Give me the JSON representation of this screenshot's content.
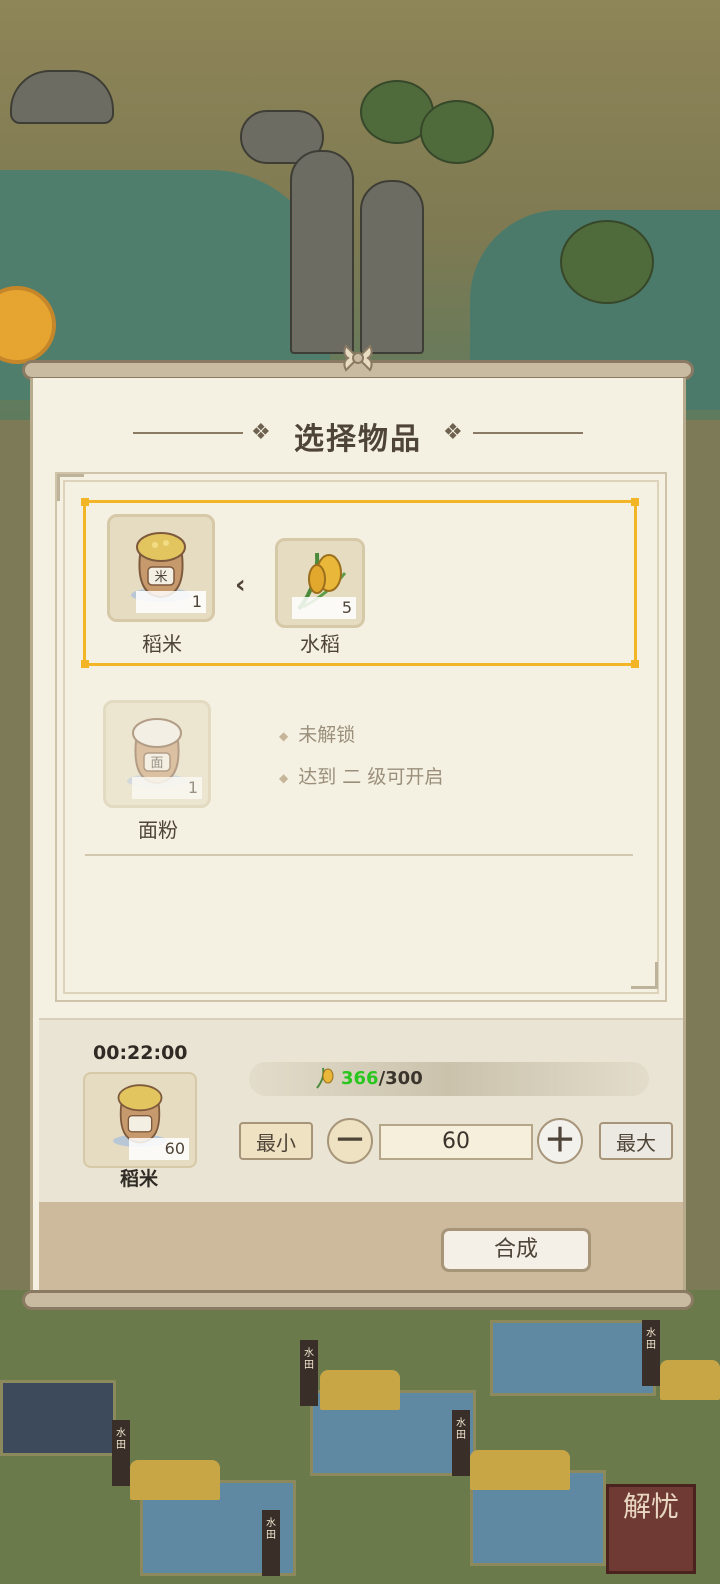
{
  "dialog": {
    "title": "选择物品"
  },
  "recipes": [
    {
      "product": {
        "name": "稻米",
        "count": "1",
        "sack_label": "米"
      },
      "ingredients": [
        {
          "name": "水稻",
          "count": "5"
        }
      ],
      "selected": true,
      "locked": false
    },
    {
      "product": {
        "name": "面粉",
        "count": "1",
        "sack_label": "面"
      },
      "locked": true,
      "lock_notes": [
        "未解锁",
        "达到 二 级可开启"
      ]
    }
  ],
  "craft": {
    "timer": "00:22:00",
    "item_name": "稻米",
    "item_count": "60",
    "resource_have": "366",
    "resource_sep": "/300",
    "min_label": "最小",
    "max_label": "最大",
    "minus_label": "－",
    "plus_label": "＋",
    "quantity": "60",
    "craft_button": "合成"
  },
  "field_signs": [
    "水田",
    "水田",
    "水田",
    "水田",
    "水田"
  ],
  "corner_badge": "解忧",
  "colors": {
    "selection": "#f1b526",
    "resource_have": "#29c61f",
    "panel_bg": "#f5f1e2"
  }
}
